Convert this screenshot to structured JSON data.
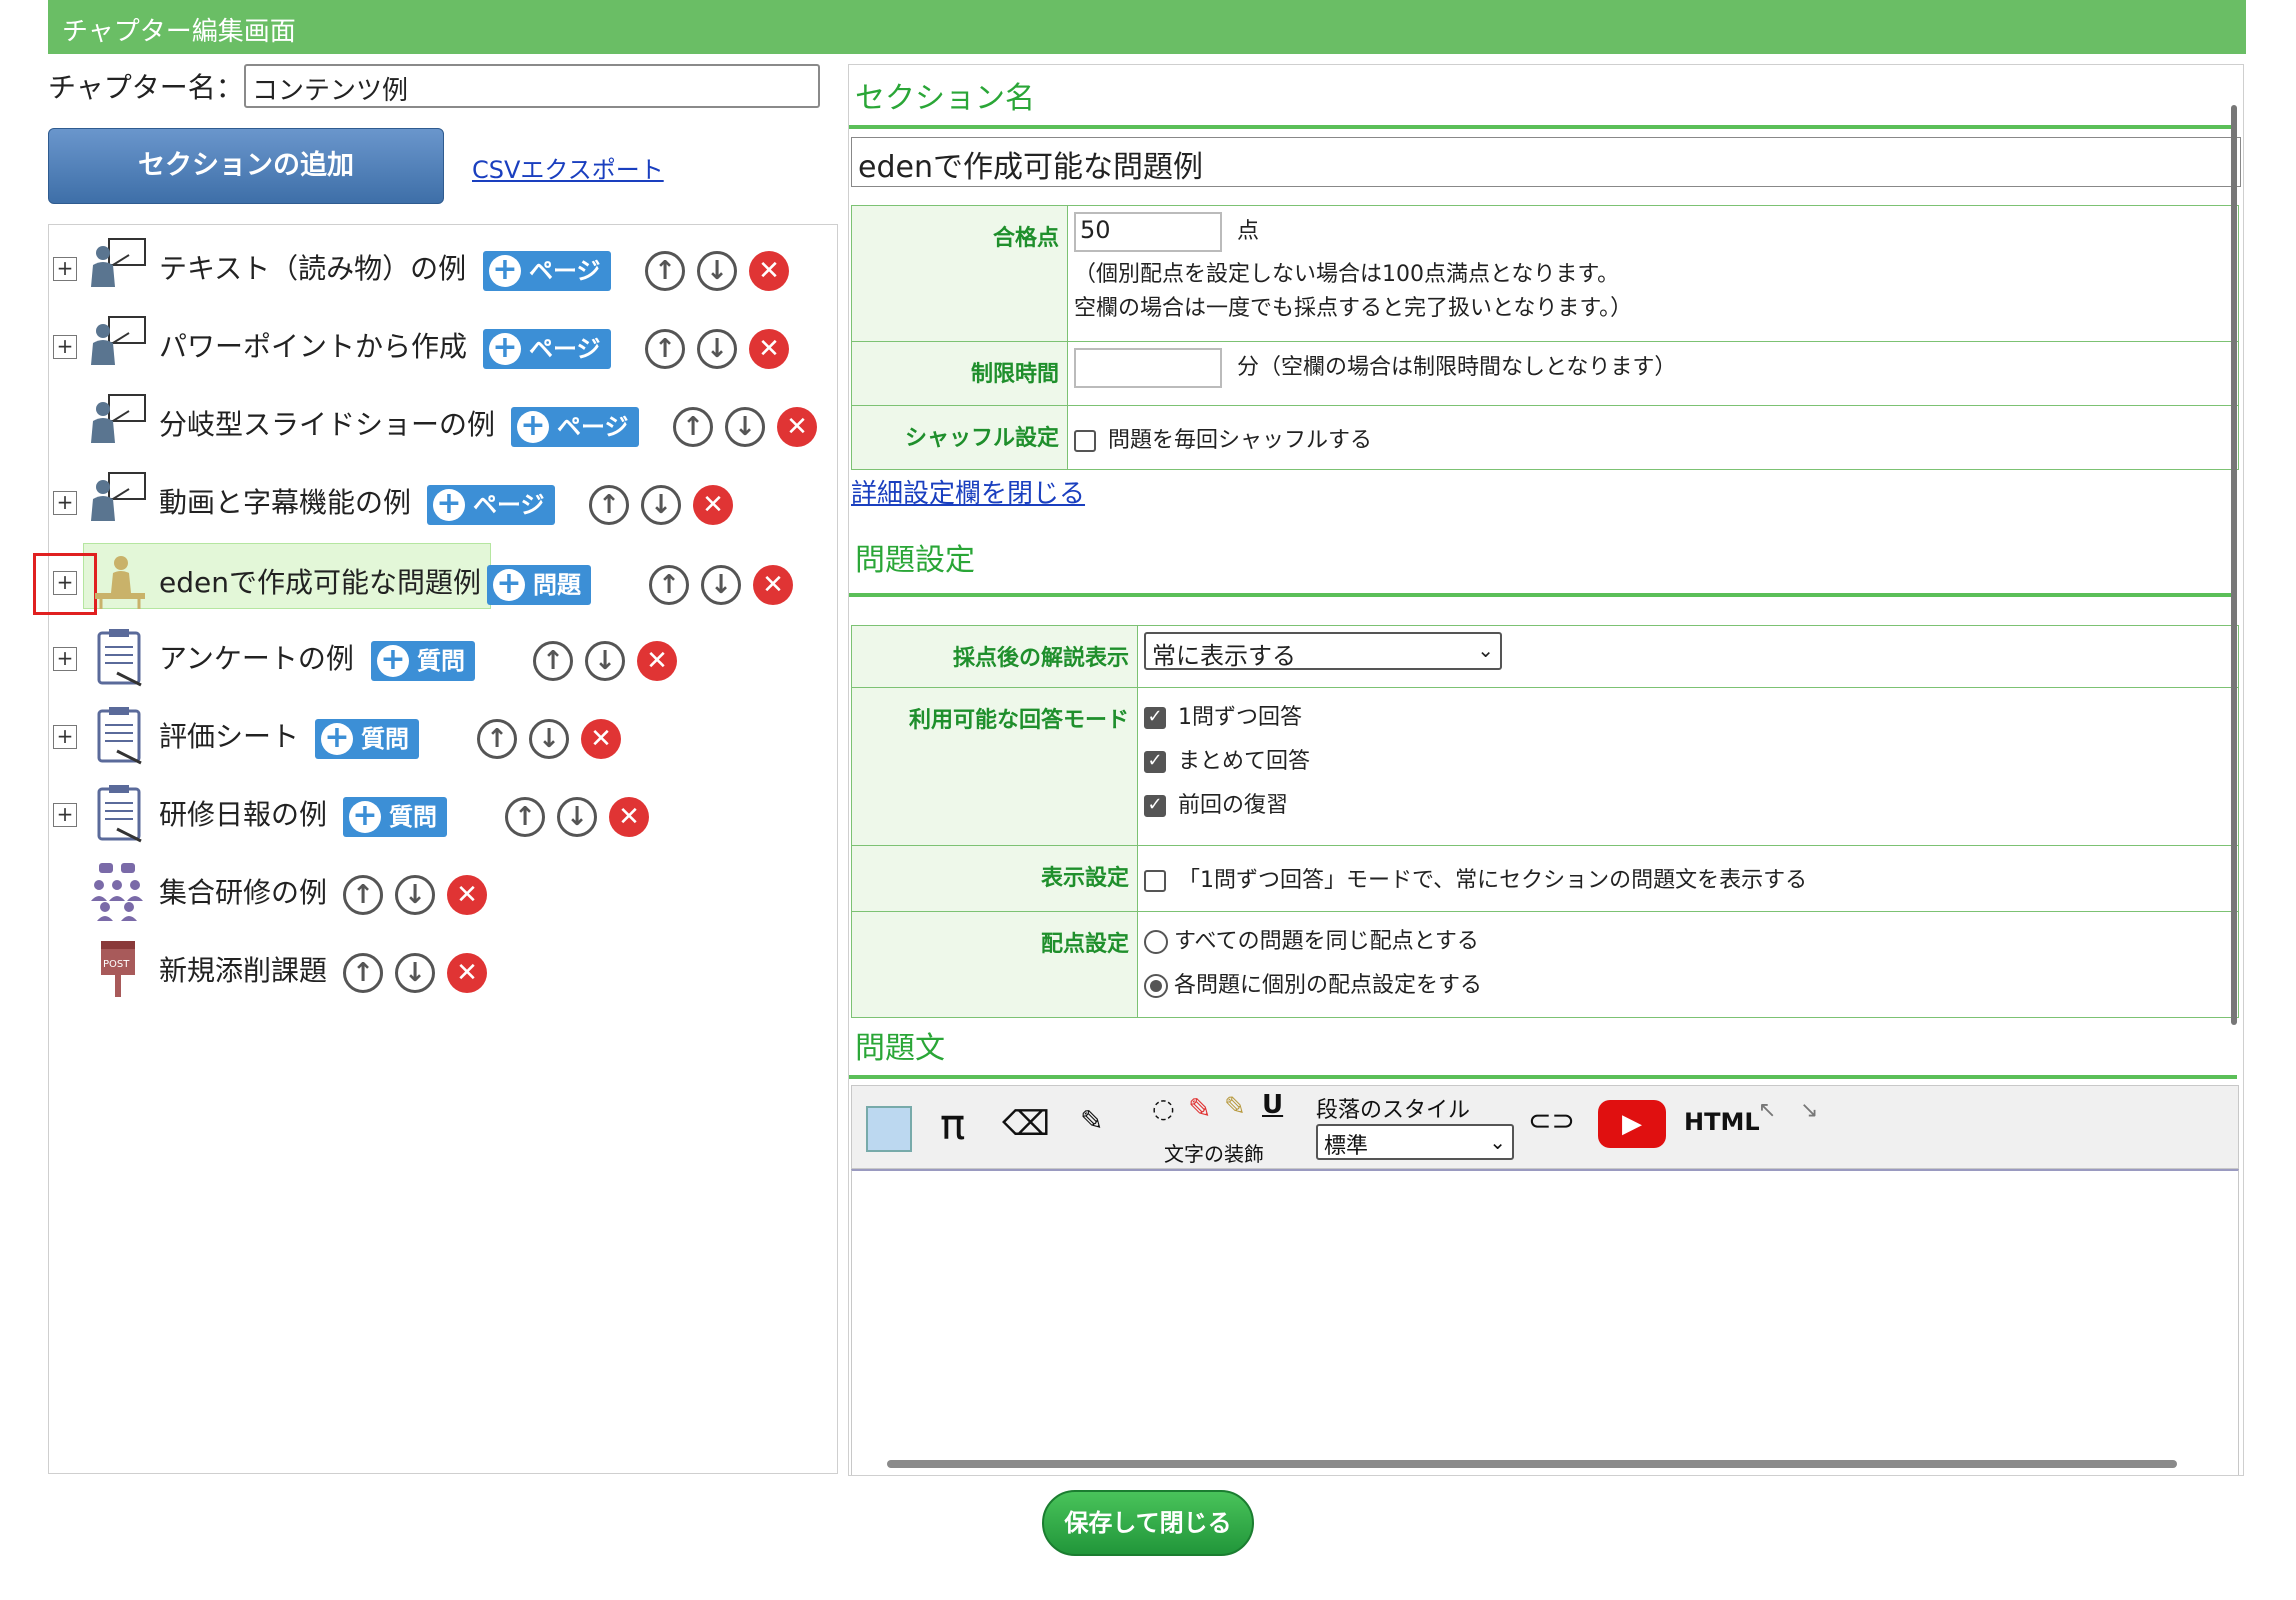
{
  "header": {
    "title": "チャプター編集画面"
  },
  "chapter": {
    "name_label": "チャプター名：",
    "name_value": "コンテンツ例"
  },
  "buttons": {
    "add_section": "セクションの追加",
    "csv_export": "CSVエクスポート",
    "save_close": "保存して閉じる"
  },
  "tree": {
    "items": [
      {
        "label": "テキスト（読み物）の例",
        "add": "ページ",
        "expand": true,
        "icon": "presenter-icon"
      },
      {
        "label": "パワーポイントから作成",
        "add": "ページ",
        "expand": true,
        "icon": "presenter-icon"
      },
      {
        "label": "分岐型スライドショーの例",
        "add": "ページ",
        "expand": false,
        "icon": "presenter-icon"
      },
      {
        "label": "動画と字幕機能の例",
        "add": "ページ",
        "expand": true,
        "icon": "presenter-icon"
      },
      {
        "label": "edenで作成可能な問題例",
        "add": "問題",
        "expand": true,
        "icon": "exam-desk-icon",
        "selected": true
      },
      {
        "label": "アンケートの例",
        "add": "質問",
        "expand": true,
        "icon": "clipboard-icon"
      },
      {
        "label": "評価シート",
        "add": "質問",
        "expand": true,
        "icon": "clipboard-icon"
      },
      {
        "label": "研修日報の例",
        "add": "質問",
        "expand": true,
        "icon": "clipboard-icon"
      },
      {
        "label": "集合研修の例",
        "add": "",
        "expand": false,
        "icon": "group-training-icon"
      },
      {
        "label": "新規添削課題",
        "add": "",
        "expand": false,
        "icon": "post-box-icon"
      }
    ]
  },
  "section": {
    "heading": "セクション名",
    "name_value": "edenで作成可能な問題例",
    "pass_label": "合格点",
    "pass_value": "50",
    "pass_unit": "点",
    "pass_note1": "（個別配点を設定しない場合は100点満点となります。",
    "pass_note2": "空欄の場合は一度でも採点すると完了扱いとなります。）",
    "time_label": "制限時間",
    "time_value": "",
    "time_note": "分（空欄の場合は制限時間なしとなります）",
    "shuffle_label": "シャッフル設定",
    "shuffle_text": "問題を毎回シャッフルする",
    "detail_link": "詳細設定欄を閉じる"
  },
  "question_settings": {
    "heading": "問題設定",
    "explain_label": "採点後の解説表示",
    "explain_value": "常に表示する",
    "mode_label": "利用可能な回答モード",
    "mode_options": [
      "1問ずつ回答",
      "まとめて回答",
      "前回の復習"
    ],
    "display_label": "表示設定",
    "display_text": "「1問ずつ回答」モードで、常にセクションの問題文を表示する",
    "score_label": "配点設定",
    "score_options": [
      "すべての問題を同じ配点とする",
      "各問題に個別の配点設定をする"
    ]
  },
  "question_text": {
    "heading": "問題文",
    "decor_label": "文字の装飾",
    "para_label": "段落のスタイル",
    "para_value": "標準",
    "html_label": "HTML"
  },
  "colors": {
    "header_green": "#6abe65",
    "accent_green": "#2aa637",
    "button_blue": "#3c8fd6",
    "delete_red": "#e03434"
  }
}
